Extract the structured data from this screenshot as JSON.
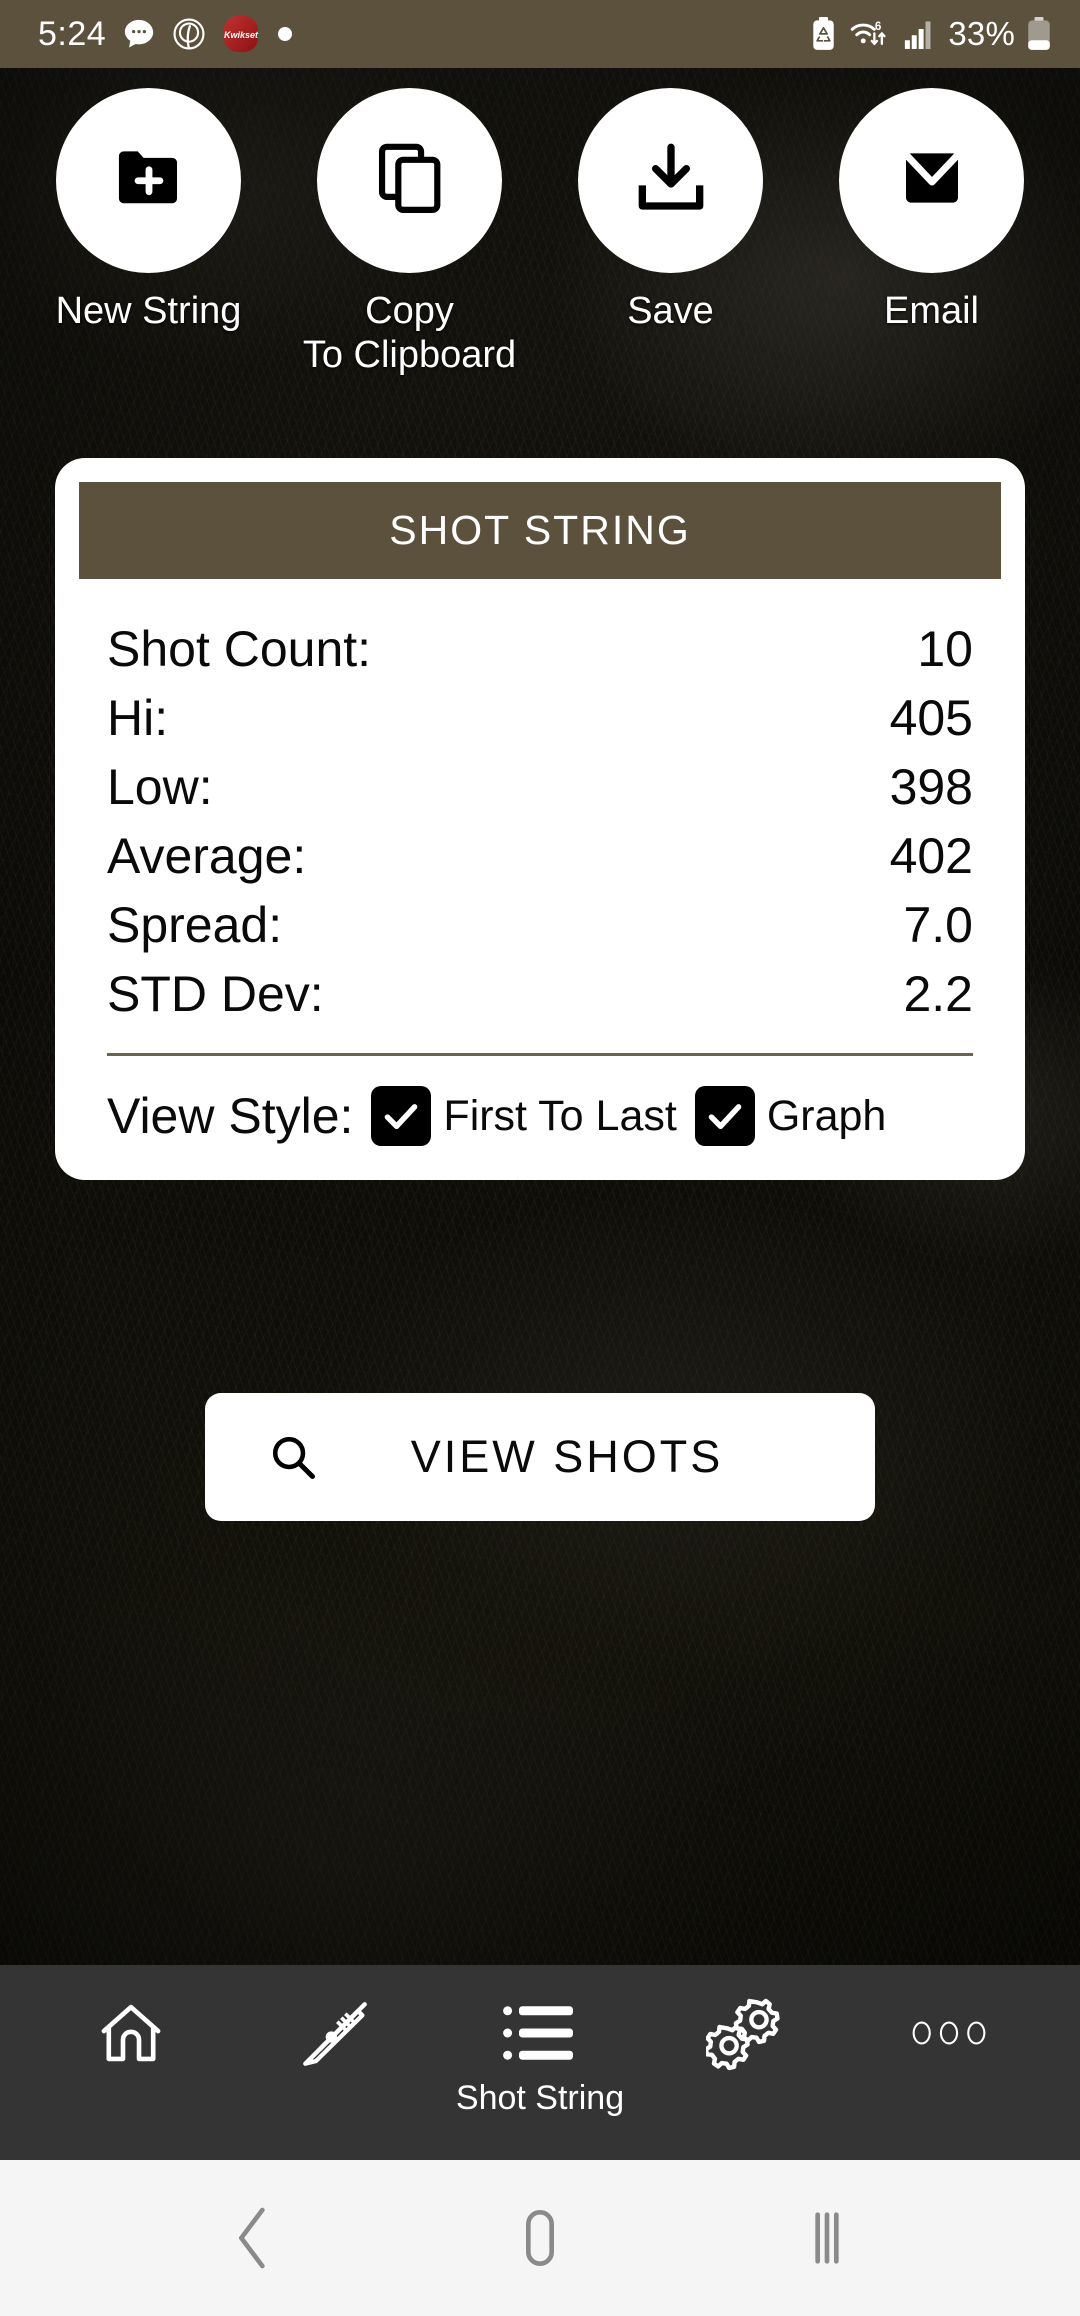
{
  "status_bar": {
    "time": "5:24",
    "battery_percent": "33%",
    "left_icons": [
      "message-bubble-icon",
      "spiral-app-icon",
      "kwikset-app-icon",
      "dot-indicator-icon"
    ],
    "kwikset_label": "Kwikset",
    "right_icons": [
      "battery-saver-icon",
      "wifi-6-icon",
      "cellular-signal-icon",
      "battery-icon"
    ],
    "background_color": "#5b513c"
  },
  "actions": [
    {
      "label": "New String",
      "icon": "folder-plus-icon"
    },
    {
      "label": "Copy\nTo Clipboard",
      "icon": "copy-icon"
    },
    {
      "label": "Save",
      "icon": "download-icon"
    },
    {
      "label": "Email",
      "icon": "envelope-icon"
    }
  ],
  "shot_card": {
    "header_title": "SHOT STRING",
    "header_color": "#5b513c",
    "stats": [
      {
        "label": "Shot Count:",
        "value": "10"
      },
      {
        "label": "Hi:",
        "value": "405"
      },
      {
        "label": "Low:",
        "value": "398"
      },
      {
        "label": "Average:",
        "value": "402"
      },
      {
        "label": "Spread:",
        "value": "7.0"
      },
      {
        "label": "STD Dev:",
        "value": "2.2"
      }
    ],
    "view_style_label": "View Style:",
    "view_style_options": [
      {
        "label": "First To Last",
        "checked": true
      },
      {
        "label": "Graph",
        "checked": true
      }
    ]
  },
  "view_shots_button": {
    "label": "VIEW SHOTS",
    "icon": "search-icon"
  },
  "bottom_nav": {
    "background_color": "#343434",
    "items": [
      {
        "label": "",
        "icon": "home-icon",
        "active": false
      },
      {
        "label": "",
        "icon": "rifle-icon",
        "active": false
      },
      {
        "label": "Shot String",
        "icon": "list-icon",
        "active": true
      },
      {
        "label": "",
        "icon": "gears-icon",
        "active": false
      },
      {
        "label": "",
        "icon": "more-dots-icon",
        "active": false
      }
    ]
  },
  "system_nav": {
    "background_color": "#f5f5f5",
    "buttons": [
      {
        "icon": "back-icon"
      },
      {
        "icon": "home-square-icon"
      },
      {
        "icon": "recents-icon"
      }
    ]
  }
}
